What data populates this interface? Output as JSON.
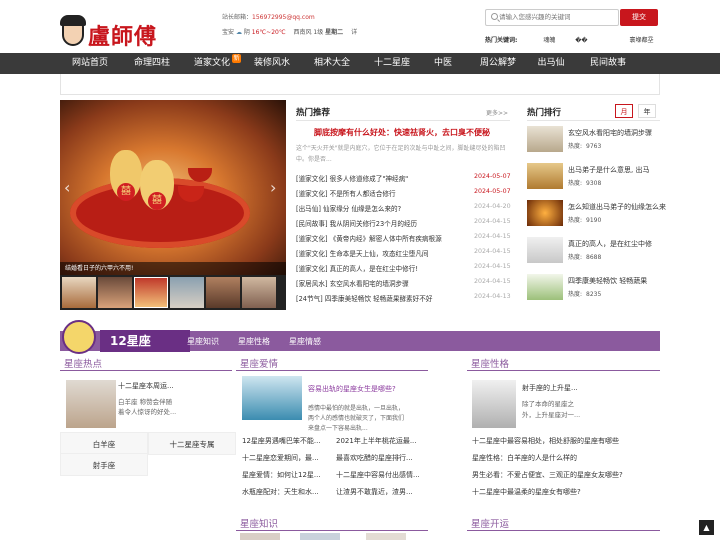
{
  "header": {
    "logo_text": "盧師傅",
    "contact_label": "站长邮箱：",
    "contact_email": "156972995@qq.com",
    "weather": {
      "city": "宝安",
      "icon": "☁",
      "cond": "阴",
      "temp": "16℃~20℃",
      "wind": "西南风 1级",
      "day": "星期二",
      "detail": "详"
    },
    "search_placeholder": "请输入您感兴趣的关键词",
    "search_button": "提交",
    "hot_keywords_label": "热门关键词:",
    "hot_keywords": [
      "魂魄",
      "��",
      "寰堢都坖"
    ]
  },
  "nav": [
    "网站首页",
    "命理四柱",
    "道家文化",
    "装修风水",
    "相术大全",
    "十二星座",
    "中医",
    "周公解梦",
    "出马仙",
    "民间故事"
  ],
  "nav_badge": "新",
  "slider": {
    "caption": "结婚看日子的六甲六不用!",
    "badge_chars": [
      "囍",
      "囍"
    ],
    "arrows": [
      "‹",
      "›"
    ]
  },
  "hot": {
    "title": "热门推荐",
    "more": "更多>>",
    "headline": "脚底按摩有什么好处：快速祛肾火，去口臭不便秘",
    "summary": "这个\"天火开关\"就是内庭穴，它位于在足的次趾与中趾之间，脚趾缝尽处的陷凹中。你是否...",
    "items": [
      {
        "title": "[道家文化] 很多人修道修成了\"神经病\"",
        "date": "2024-05-07",
        "hot": true
      },
      {
        "title": "[道家文化] 不是所有人都适合修行",
        "date": "2024-05-07",
        "hot": true
      },
      {
        "title": "[出马仙] 仙家缘分 仙缘是怎么来的?",
        "date": "2024-04-20",
        "hot": false
      },
      {
        "title": "[民间故事] 我从阴间关修行23个月的经历",
        "date": "2024-04-15",
        "hot": false
      },
      {
        "title": "[道家文化] 《黄帝内经》解密人体中所有疾病根源",
        "date": "2024-04-15",
        "hot": false
      },
      {
        "title": "[道家文化] 生命本是天上仙，攻态红尘堕凡间",
        "date": "2024-04-15",
        "hot": false
      },
      {
        "title": "[道家文化] 真正的高人，是在红尘中修行!",
        "date": "2024-04-15",
        "hot": false
      },
      {
        "title": "[家居风水] 玄空风水看阳宅的墙洞步骤",
        "date": "2024-04-15",
        "hot": false
      },
      {
        "title": "[24节气] 四季康美轻畅饮 轻畅蔬果酵素好不好",
        "date": "2024-04-13",
        "hot": false
      }
    ]
  },
  "ranking": {
    "title": "热门排行",
    "tabs": [
      "月",
      "年"
    ],
    "items": [
      {
        "title": "玄空风水看阳宅的墙洞步骤",
        "heat_label": "热度:",
        "heat": "9763"
      },
      {
        "title": "出马弟子是什么意思, 出马",
        "heat_label": "热度:",
        "heat": "9308"
      },
      {
        "title": "怎么知道出马弟子的仙缘怎么来",
        "heat_label": "热度:",
        "heat": "9190"
      },
      {
        "title": "真正的高人，是在红尘中修",
        "heat_label": "热度:",
        "heat": "8688"
      },
      {
        "title": "四季康美轻畅饮 轻畅蔬果",
        "heat_label": "热度:",
        "heat": "8235"
      }
    ]
  },
  "xingzuo": {
    "band_title": "12星座",
    "band_links": [
      "星座知识",
      "星座性格",
      "星座情感"
    ],
    "hotspot": {
      "title": "星座热点",
      "article_title": "十二星座本周运...",
      "article_desc1": "白羊座 称赞会伴随",
      "article_desc2": "着令人惊讶的好处...",
      "grid": [
        "白羊座",
        "十二星座专属",
        "射手座"
      ]
    },
    "love": {
      "title": "星座爱情",
      "article_title": "容易出轨的星座女生是哪些?",
      "article_desc1": "感情中最怕的就是出轨，一旦出轨，",
      "article_desc2": "两个人的感情也就破灭了，下面我们",
      "article_desc3": "来盘点一下容易出轨...",
      "links": [
        [
          "12星座男遇嘴巴笨不能...",
          "2021年上半年桃花运最..."
        ],
        [
          "十二星座恋爱期间，最...",
          "最喜欢吃醋的星座排行..."
        ],
        [
          "星座爱情：如何让12星...",
          "十二星座中容易付出感情..."
        ],
        [
          "水瓶座配对：天生和水...",
          "让渣男不敢靠近，渣男..."
        ]
      ]
    },
    "character": {
      "title": "星座性格",
      "article_title": "射手座的上升星...",
      "article_desc1": "除了本命的星座之",
      "article_desc2": "外，上升星座对一...",
      "links": [
        "十二星座中最容易相处，相处舒服的星座有哪些",
        "星座性格：白羊座的人是什么样的",
        "男生必看：不爱占便宜、三观正的星座女友哪些?",
        "十二星座中最温柔的星座女有哪些?"
      ]
    },
    "knowledge_title": "星座知识",
    "fortune_title": "星座开运"
  },
  "backtop": "▲"
}
